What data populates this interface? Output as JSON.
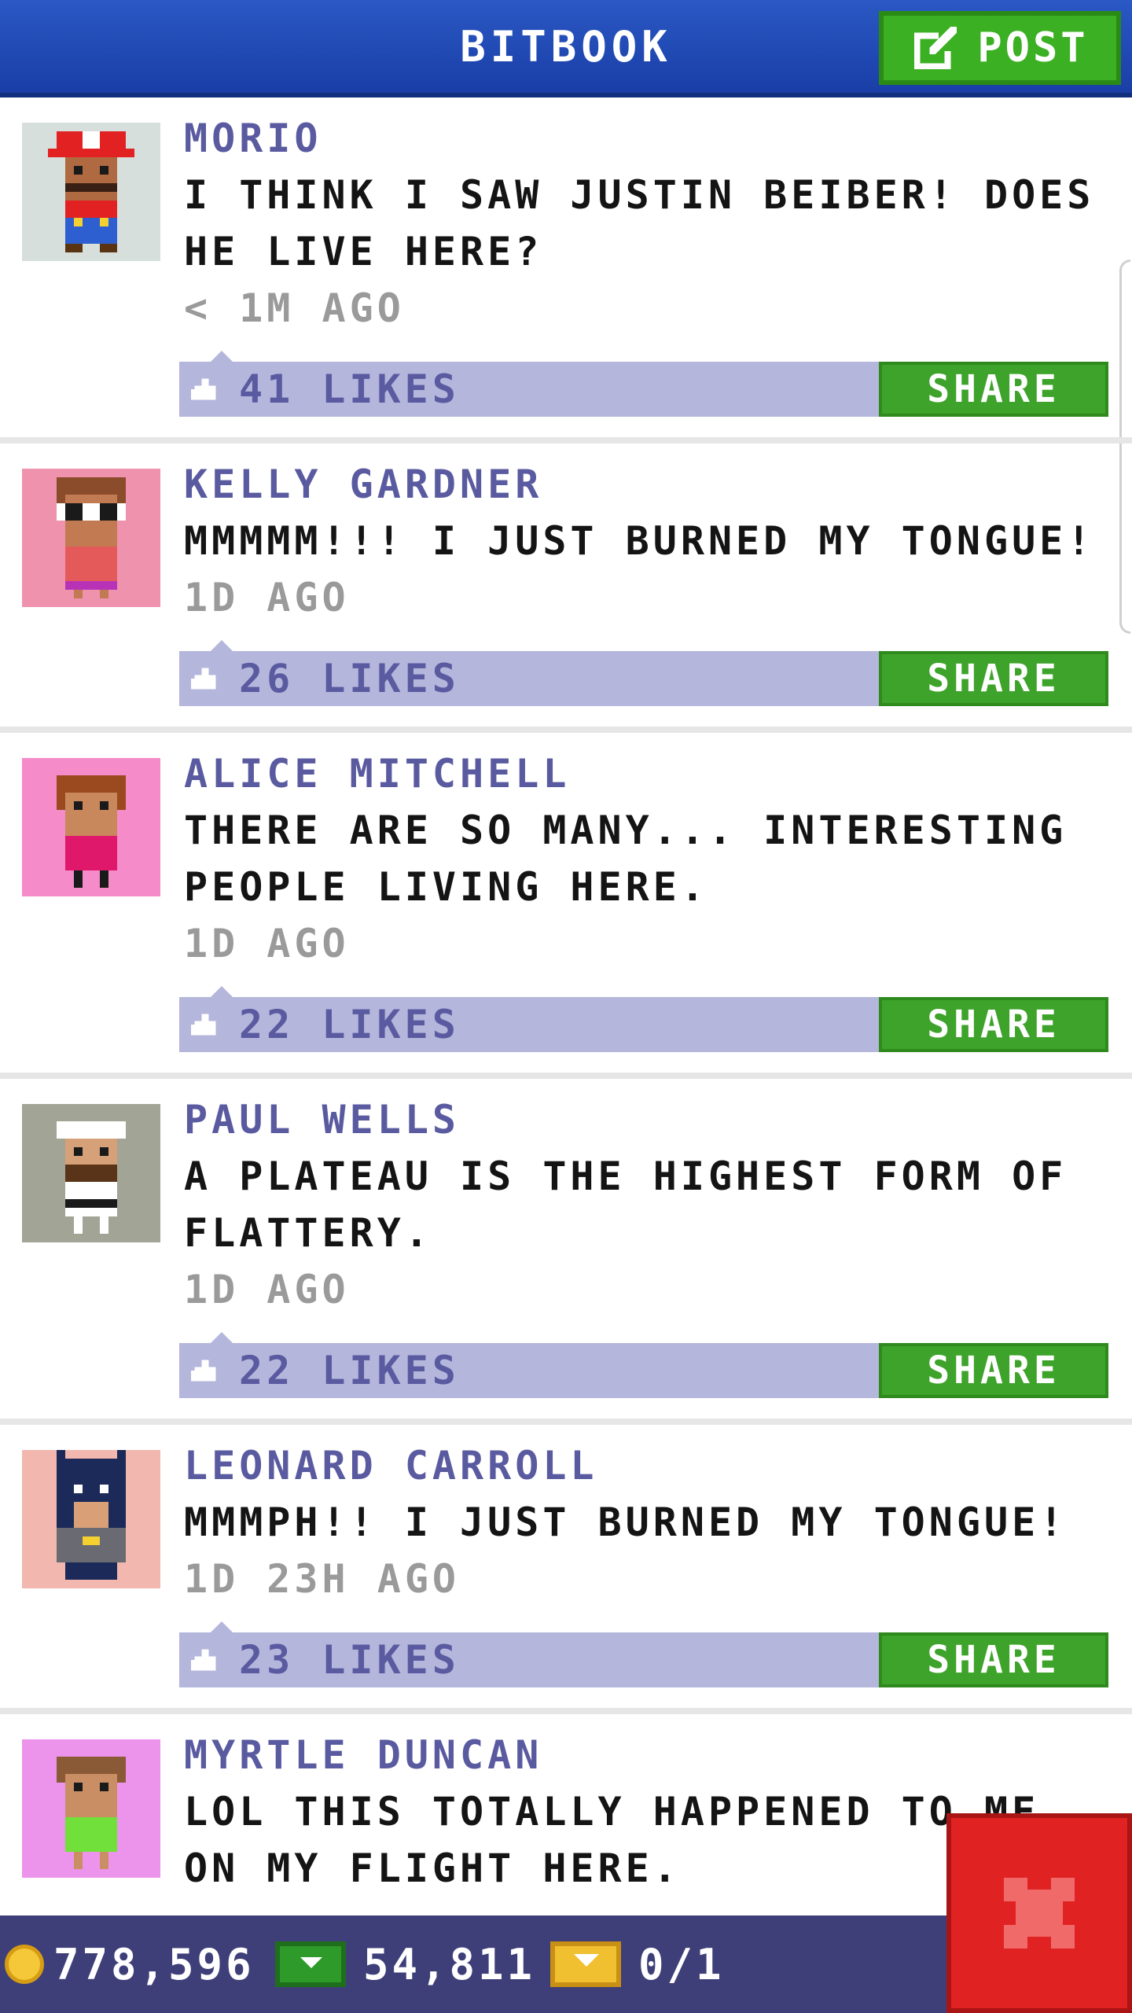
{
  "header": {
    "title": "BITBOOK",
    "post_label": "POST"
  },
  "posts": [
    {
      "author": "MORIO",
      "message": "I THINK I SAW JUSTIN BEIBER! DOES HE LIVE HERE?",
      "time": "< 1M AGO",
      "likes": "41 LIKES",
      "share": "SHARE",
      "avatar_bg": "#d6dfdc"
    },
    {
      "author": "KELLY GARDNER",
      "message": "MMMMM!!! I JUST BURNED MY TONGUE!",
      "time": "1D AGO",
      "likes": "26 LIKES",
      "share": "SHARE",
      "avatar_bg": "#ee92ae"
    },
    {
      "author": "ALICE MITCHELL",
      "message": "THERE ARE SO MANY... INTERESTING PEOPLE LIVING HERE.",
      "time": "1D AGO",
      "likes": "22 LIKES",
      "share": "SHARE",
      "avatar_bg": "#f58bc8"
    },
    {
      "author": "PAUL WELLS",
      "message": "A PLATEAU IS THE HIGHEST FORM OF FLATTERY.",
      "time": "1D AGO",
      "likes": "22 LIKES",
      "share": "SHARE",
      "avatar_bg": "#a2a496"
    },
    {
      "author": "LEONARD CARROLL",
      "message": "MMMPH!! I JUST BURNED MY TONGUE!",
      "time": "1D 23H AGO",
      "likes": "23 LIKES",
      "share": "SHARE",
      "avatar_bg": "#f2b7ae"
    },
    {
      "author": "MYRTLE DUNCAN",
      "message": "LOL THIS TOTALLY HAPPENED TO ME ON MY FLIGHT HERE.",
      "time": "",
      "likes": "",
      "share": "",
      "avatar_bg": "#ec94ec"
    }
  ],
  "status": {
    "coins": "778,596",
    "bux": "54,811",
    "tickets": "0/1"
  },
  "colors": {
    "header": "#1f47b3",
    "accent_green": "#3ea32a",
    "likes_bar": "#b4b6dc",
    "status_bar": "#3e3f78",
    "close": "#e02222"
  }
}
